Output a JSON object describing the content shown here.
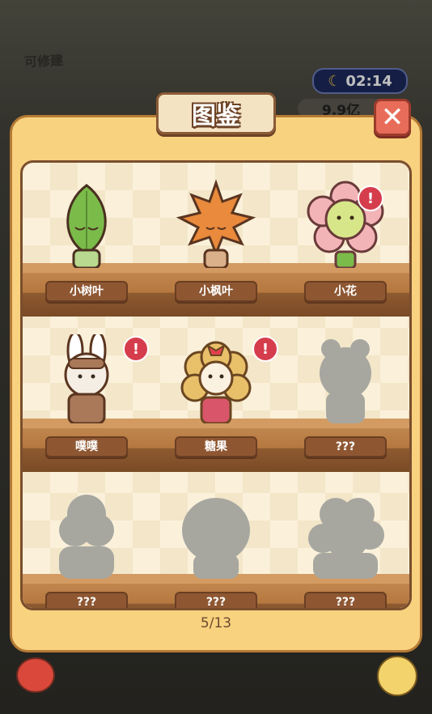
{
  "background": {
    "sign_text": "可修建",
    "time": "02:14",
    "money": "9.9亿"
  },
  "dialog": {
    "title": "图鉴",
    "close_label": "✕",
    "page": "5/13",
    "badge_glyph": "!",
    "cells": [
      {
        "name": "小树叶",
        "unlocked": true,
        "alert": false
      },
      {
        "name": "小枫叶",
        "unlocked": true,
        "alert": false
      },
      {
        "name": "小花",
        "unlocked": true,
        "alert": true
      },
      {
        "name": "噗噗",
        "unlocked": true,
        "alert": true
      },
      {
        "name": "糖果",
        "unlocked": true,
        "alert": true
      },
      {
        "name": "???",
        "unlocked": false,
        "alert": false
      },
      {
        "name": "???",
        "unlocked": false,
        "alert": false
      },
      {
        "name": "???",
        "unlocked": false,
        "alert": false
      },
      {
        "name": "???",
        "unlocked": false,
        "alert": false
      }
    ]
  },
  "colors": {
    "panel": "#f8d27f",
    "close": "#e76d5a",
    "badge": "#d63d4c",
    "shelf": "#b5783f",
    "silhouette": "#a7a7a0"
  }
}
